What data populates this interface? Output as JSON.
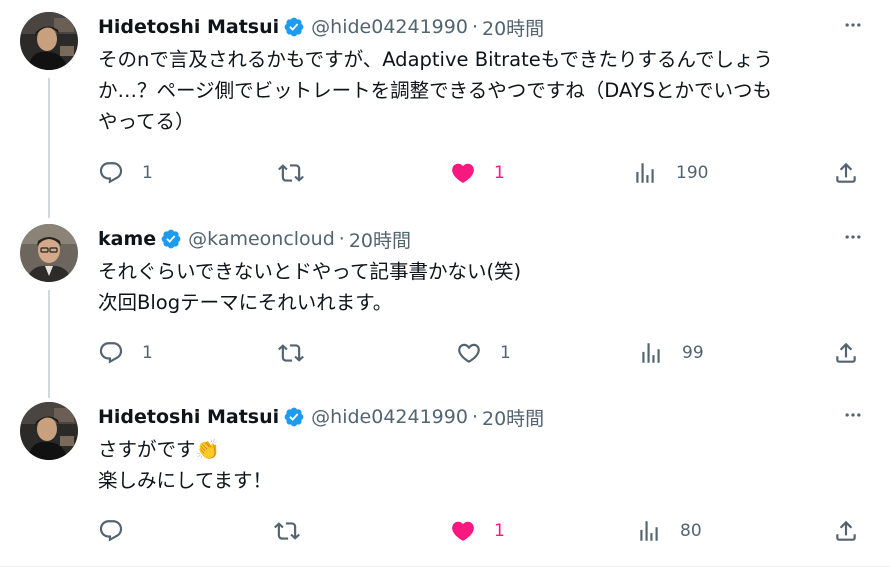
{
  "tweets": [
    {
      "name": "Hidetoshi Matsui",
      "handle": "@hide04241990",
      "dot": "·",
      "time": "20時間",
      "lines": [
        "そのnで言及されるかもですが、Adaptive Bitrateもできたりするんでしょう",
        "か…？ページ側でビットレートを調整できるやつですね（DAYSとかでいつも",
        "やってる）"
      ],
      "reply_count": "1",
      "retweet_count": "",
      "like_count": "1",
      "liked": true,
      "view_count": "190",
      "avatar_icon": "avatar-photo-hidetoshi"
    },
    {
      "name": "kame",
      "handle": "@kameoncloud",
      "dot": "·",
      "time": "20時間",
      "lines": [
        "それぐらいできないとドやって記事書かない(笑)",
        "次回Blogテーマにそれいれます。"
      ],
      "reply_count": "1",
      "retweet_count": "",
      "like_count": "1",
      "liked": false,
      "view_count": "99",
      "avatar_icon": "avatar-photo-kame"
    },
    {
      "name": "Hidetoshi Matsui",
      "handle": "@hide04241990",
      "dot": "·",
      "time": "20時間",
      "lines": [
        "さすがです👏",
        "楽しみにしてます！"
      ],
      "reply_count": "",
      "retweet_count": "",
      "like_count": "1",
      "liked": true,
      "view_count": "80",
      "avatar_icon": "avatar-photo-hidetoshi"
    }
  ],
  "colors": {
    "verified": "#1d9bf0",
    "like_active": "#f91880",
    "secondary_text": "#536471",
    "thread_line": "#cfd9de"
  }
}
